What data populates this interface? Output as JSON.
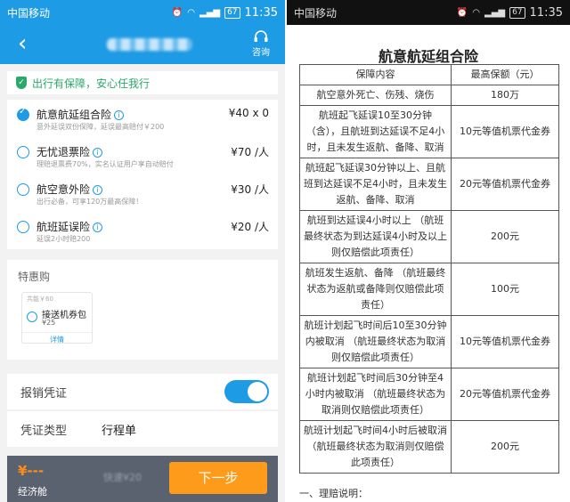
{
  "status_bar": {
    "carrier": "中国移动",
    "battery": "67",
    "time": "11:35"
  },
  "left": {
    "header": {
      "back_icon": "chevron-left-icon",
      "consult_label": "咨询"
    },
    "banner": {
      "text": "出行有保障，安心任我行"
    },
    "insurance_items": [
      {
        "name": "航意航延组合险",
        "desc": "意外延误双份保障，延误最高赔付￥200",
        "price": "¥40 x 0",
        "selected": true
      },
      {
        "name": "无忧退票险",
        "desc": "理赔退票费70%，实名认证用户享自动赔付",
        "price": "¥70 /人",
        "selected": false
      },
      {
        "name": "航空意外险",
        "desc": "出行必备，可享120万最高保障！",
        "price": "¥30 /人",
        "selected": false
      },
      {
        "name": "航班延误险",
        "desc": "延误2小时赔200",
        "price": "¥20 /人",
        "selected": false
      }
    ],
    "special": {
      "title": "特惠购",
      "coupon": {
        "tag": "共能￥60",
        "name": "接送机券包",
        "price": "¥25",
        "detail": "详情"
      }
    },
    "invoice": {
      "label": "报销凭证",
      "type_label": "凭证类型",
      "type_value": "行程单",
      "toggle_on": true
    },
    "bottom": {
      "price": "¥---",
      "cabin": "经济舱",
      "detail": "快速¥20",
      "next_label": "下一步"
    }
  },
  "right": {
    "title": "航意航延组合险",
    "table": {
      "headers": [
        "保障内容",
        "最高保额（元）"
      ],
      "rows": [
        [
          "航空意外死亡、伤残、烧伤",
          "180万"
        ],
        [
          "航班起飞延误10至30分钟（含），且航班到达延误不足4小时，且未发生返航、备降、取消",
          "10元等值机票代金券"
        ],
        [
          "航班起飞延误30分钟以上、且航班到达延误不足4小时，且未发生返航、备降、取消",
          "20元等值机票代金券"
        ],
        [
          "航班到达延误4小时以上 （航班最终状态为到达延误4小时及以上则仅赔偿此项责任）",
          "200元"
        ],
        [
          "航班发生返航、备降 （航班最终状态为返航或备降则仅赔偿此项责任）",
          "100元"
        ],
        [
          "航班计划起飞时间后10至30分钟内被取消 （航班最终状态为取消则仅赔偿此项责任）",
          "10元等值机票代金券"
        ],
        [
          "航班计划起飞时间后30分钟至4小时内被取消 （航班最终状态为取消则仅赔偿此项责任）",
          "20元等值机票代金券"
        ],
        [
          "航班计划起飞时间4小时后被取消 （航班最终状态为取消则仅赔偿此项责任）",
          "200元"
        ]
      ]
    },
    "footnote": "一、理赔说明："
  }
}
